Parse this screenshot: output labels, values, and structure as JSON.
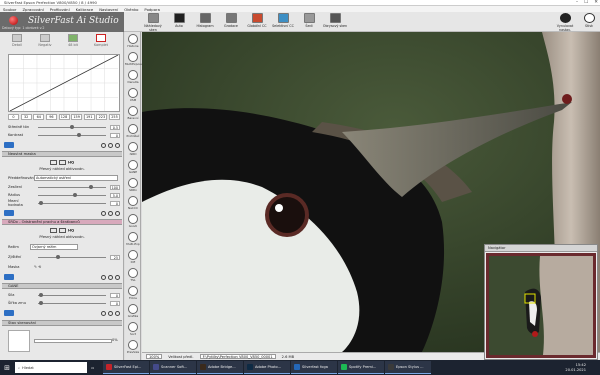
{
  "window": {
    "title": "SilverFast Epson Perfection V800/V850 / 8 / 4990",
    "controls": [
      "–",
      "☐",
      "✕"
    ]
  },
  "menu": [
    "Soubor",
    "Zpracování",
    "Profilování",
    "Kalibrace",
    "Nastavení",
    "Okénko",
    "Podpora"
  ],
  "logo": {
    "brand": "SilverFast Ai Studio",
    "sub": "Datový typ: 1 obrázek v.2",
    "icon": "silverfast-logo"
  },
  "toolbar": {
    "items": [
      {
        "label": "Náhledový sken",
        "icon": "prescan-icon",
        "color": "#888888"
      },
      {
        "label": "Auto",
        "icon": "auto-icon",
        "color": "#202020"
      },
      {
        "label": "Histogram",
        "icon": "histogram-icon",
        "color": "#666666"
      },
      {
        "label": "Gradace",
        "icon": "gradation-icon",
        "color": "#777777"
      },
      {
        "label": "Globální CC",
        "icon": "global-cc-icon",
        "color": "#c94b2f"
      },
      {
        "label": "Selektivní CC",
        "icon": "selective-cc-icon",
        "color": "#3e8fc4"
      },
      {
        "label": "Šedi",
        "icon": "grey-icon",
        "color": "#999999"
      },
      {
        "label": "Obrysový sken",
        "icon": "frame-scan-icon",
        "color": "#555555"
      }
    ],
    "right": [
      {
        "label": "Vynulovat nastav.",
        "icon": "reset-icon"
      },
      {
        "label": "Stisk",
        "icon": "scan-icon"
      }
    ]
  },
  "modes": [
    {
      "label": "Detail"
    },
    {
      "label": "Negativ"
    },
    {
      "label": "48 bit"
    },
    {
      "label": "Komplet"
    }
  ],
  "curve_values": [
    "0",
    "32",
    "64",
    "96",
    "128",
    "159",
    "191",
    "223",
    "255"
  ],
  "sliders1": [
    {
      "label": "Středně tón",
      "value": "0.5",
      "pos": 0.5
    },
    {
      "label": "Kontrast",
      "value": "0",
      "pos": 0.6
    }
  ],
  "section1": {
    "title": "Neostrá maska",
    "preview": "Přesný náhled aktivován.",
    "predefined_label": "Předdefinování",
    "predefined_value": "Automatický ostření",
    "sliders": [
      {
        "label": "Zesílení",
        "value": "100",
        "pos": 0.78
      },
      {
        "label": "Rádius",
        "value": "5.0",
        "pos": 0.55
      },
      {
        "label": "Mezní hodnota",
        "value": "0",
        "pos": 0.05
      }
    ]
  },
  "section2": {
    "title": "SRDx - Odstranění prachu a škrábanců",
    "preview": "Přesný náhled aktivován.",
    "mode_label": "Režim",
    "mode_value": "Ovjarný režim",
    "slider": {
      "label": "Zjištění",
      "value": "25",
      "pos": 0.3
    },
    "mask_label": "Maska"
  },
  "section3": {
    "title": "GANE",
    "sliders": [
      {
        "label": "Síla",
        "value": "0",
        "pos": 0.05
      },
      {
        "label": "Šířka zrnu",
        "value": "0",
        "pos": 0.05
      }
    ]
  },
  "section4": {
    "title": "Stav skenování",
    "percent": "0%"
  },
  "vertical_tools": [
    {
      "label": "Historie",
      "icon": "history-icon"
    },
    {
      "label": "MultiExposure",
      "icon": "multi-exposure-icon"
    },
    {
      "label": "Densita",
      "icon": "density-icon"
    },
    {
      "label": "USM",
      "icon": "usm-icon"
    },
    {
      "label": "Barevní",
      "icon": "color-icon"
    },
    {
      "label": "Prohlížeč",
      "icon": "viewer-icon"
    },
    {
      "label": "iSRD",
      "icon": "isrd-icon"
    },
    {
      "label": "GANE",
      "icon": "gane-icon"
    },
    {
      "label": "SRDx",
      "icon": "srdx-icon"
    },
    {
      "label": "NaCCC",
      "icon": "naccc-icon"
    },
    {
      "label": "Goodi",
      "icon": "goodi-icon"
    },
    {
      "label": "Multi-Exp",
      "icon": "multi-exp-icon"
    },
    {
      "label": "ICE",
      "icon": "ice-icon"
    },
    {
      "label": "TSL",
      "icon": "tsl-icon"
    },
    {
      "label": "Fotos",
      "icon": "fotos-icon"
    },
    {
      "label": "Grafika",
      "icon": "grafika-icon"
    },
    {
      "label": "Sort",
      "icon": "sort-icon"
    },
    {
      "label": "PrevSize",
      "icon": "prevsize-icon"
    }
  ],
  "image_status": {
    "zoom": "100%",
    "label": "Velikost předl.",
    "file": "F:\\Pytlíky\\Perfection V800_V850_00001",
    "size": "2.6 MB"
  },
  "navigator": {
    "title": "Navigátor"
  },
  "taskbar": {
    "search": "Hledat",
    "apps": [
      {
        "label": "SilverFast Epi...",
        "color": "#c4242a"
      },
      {
        "label": "Scanner Soft...",
        "color": "#444a8a"
      },
      {
        "label": "Adobe Bridge...",
        "color": "#3a2a1c"
      },
      {
        "label": "Adobe Photo...",
        "color": "#0e2a44"
      },
      {
        "label": "Silverfast foga",
        "color": "#2467b8"
      },
      {
        "label": "Spotify Premi...",
        "color": "#1db954"
      },
      {
        "label": "Epson Stylus ...",
        "color": "#3a3a3a"
      }
    ],
    "time": "15:42",
    "date": "20.01.2021"
  }
}
